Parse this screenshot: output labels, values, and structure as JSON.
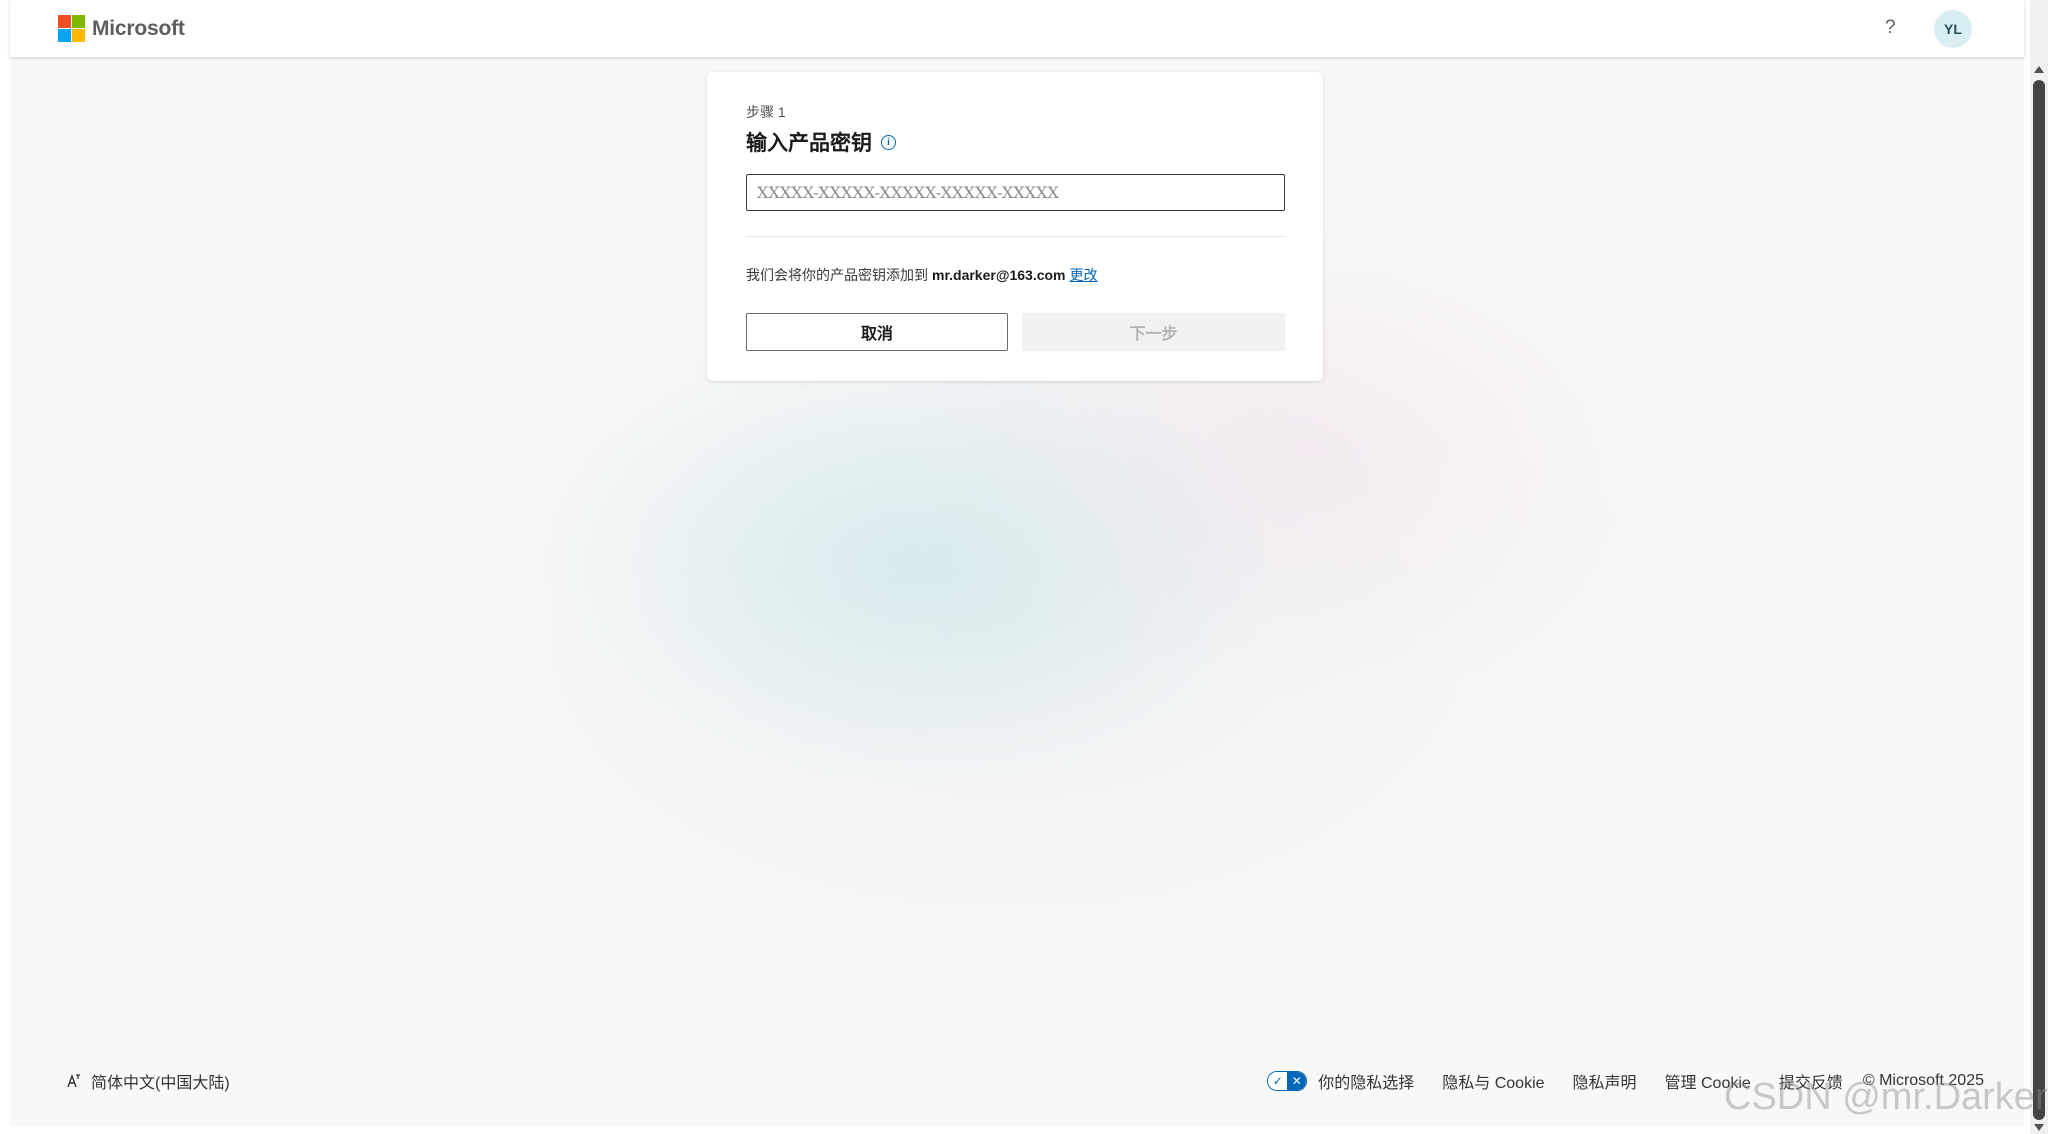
{
  "header": {
    "brand": "Microsoft",
    "help_label": "?",
    "avatar_initials": "YL"
  },
  "card": {
    "step_label": "步骤 1",
    "title": "输入产品密钥",
    "info_icon": "i",
    "key_input": {
      "value": "",
      "placeholder": "XXXXX-XXXXX-XXXXX-XXXXX-XXXXX"
    },
    "note_prefix": "我们会将你的产品密钥添加到",
    "note_email": "mr.darker@163.com",
    "note_change": "更改",
    "cancel_label": "取消",
    "next_label": "下一步"
  },
  "footer": {
    "language": "简体中文(中国大陆)",
    "privacy_choice": "你的隐私选择",
    "privacy_cookie": "隐私与 Cookie",
    "privacy_statement": "隐私声明",
    "manage_cookie": "管理 Cookie",
    "feedback": "提交反馈",
    "copyright": "© Microsoft 2025"
  },
  "watermark": "CSDN @mr.Darker",
  "colors": {
    "accent": "#0067b8",
    "logo_red": "#f25022",
    "logo_green": "#7fba00",
    "logo_blue": "#00a4ef",
    "logo_yellow": "#ffb900",
    "avatar_bg": "#d9eef3"
  }
}
